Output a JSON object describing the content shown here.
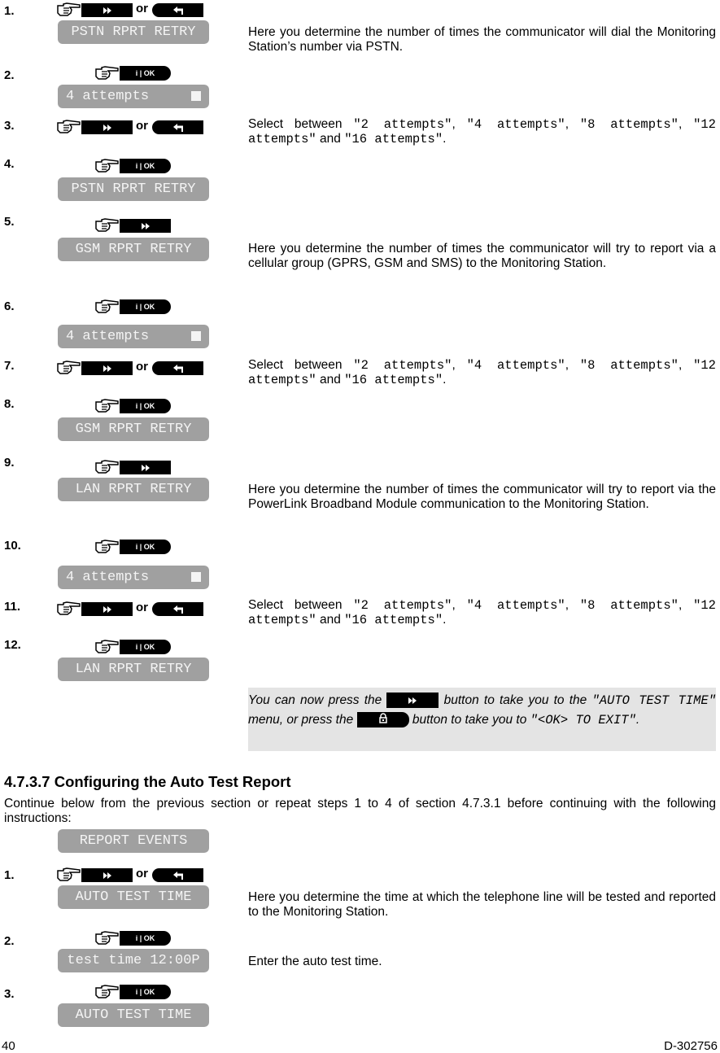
{
  "steps_a": [
    {
      "num": "1.",
      "keys": "next-or-back",
      "lcd": "PSTN RPRT RETRY"
    },
    {
      "num": "2.",
      "keys": "ok",
      "lcd": "4 attempts",
      "lcd_cursor": true
    },
    {
      "num": "3.",
      "keys": "next-or-back"
    },
    {
      "num": "4.",
      "keys": "ok",
      "lcd": "PSTN RPRT RETRY"
    },
    {
      "num": "5.",
      "keys": "next",
      "lcd": "GSM RPRT RETRY"
    },
    {
      "num": "6.",
      "keys": "ok",
      "lcd": "4 attempts",
      "lcd_cursor": true
    },
    {
      "num": "7.",
      "keys": "next-or-back"
    },
    {
      "num": "8.",
      "keys": "ok",
      "lcd": "GSM RPRT RETRY"
    },
    {
      "num": "9.",
      "keys": "next",
      "lcd": "LAN RPRT RETRY"
    },
    {
      "num": "10.",
      "keys": "ok",
      "lcd": "4 attempts",
      "lcd_cursor": true
    },
    {
      "num": "11.",
      "keys": "next-or-back"
    },
    {
      "num": "12.",
      "keys": "ok",
      "lcd": "LAN RPRT RETRY"
    }
  ],
  "or_label": "or",
  "ok_key_label": "i | OK",
  "descriptions": {
    "pstn": "Here you determine the number of times the communicator will dial the Monitoring Station’s number via PSTN.",
    "gsm": "Here you determine the number of times the communicator will try to report via a cellular group (GPRS, GSM and SMS) to the Monitoring Station.",
    "lan": "Here you determine the number of times the communicator will try to report via the PowerLink Broadband Module communication to the Monitoring Station.",
    "select": {
      "prefix": "Select between ",
      "opt1": "\"2 attempts\"",
      "opt2": "\"4 attempts\"",
      "opt3": "\"8 attempts\"",
      "opt4a": "\"12",
      "opt4b": "attempts\"",
      "and": " and ",
      "opt5": "\"16 attempts\"",
      "end": "."
    }
  },
  "note": {
    "part1": "You can now press the",
    "part2": "button to take you to the ",
    "menu": "\"AUTO TEST TIME\"",
    "part3": " menu, or press the",
    "part4": "button to take you to ",
    "exit": "\"<OK> TO EXIT\"",
    "end": "."
  },
  "section": {
    "heading": "4.7.3.7 Configuring the Auto Test Report",
    "intro": "Continue below from the previous section or repeat steps 1 to 4 of section 4.7.3.1 before continuing with the following instructions:",
    "start_lcd": "REPORT EVENTS"
  },
  "steps_b": [
    {
      "num": "1.",
      "keys": "next-or-back",
      "lcd": "AUTO TEST TIME"
    },
    {
      "num": "2.",
      "keys": "ok",
      "lcd": "test time 12:00P"
    },
    {
      "num": "3.",
      "keys": "ok",
      "lcd": "AUTO TEST TIME"
    }
  ],
  "descriptions_b": {
    "auto_test": "Here you determine the time at which the telephone line will be tested and reported to the Monitoring Station.",
    "enter_time": "Enter the auto test time."
  },
  "footer": {
    "page": "40",
    "doc_id": "D-302756"
  }
}
